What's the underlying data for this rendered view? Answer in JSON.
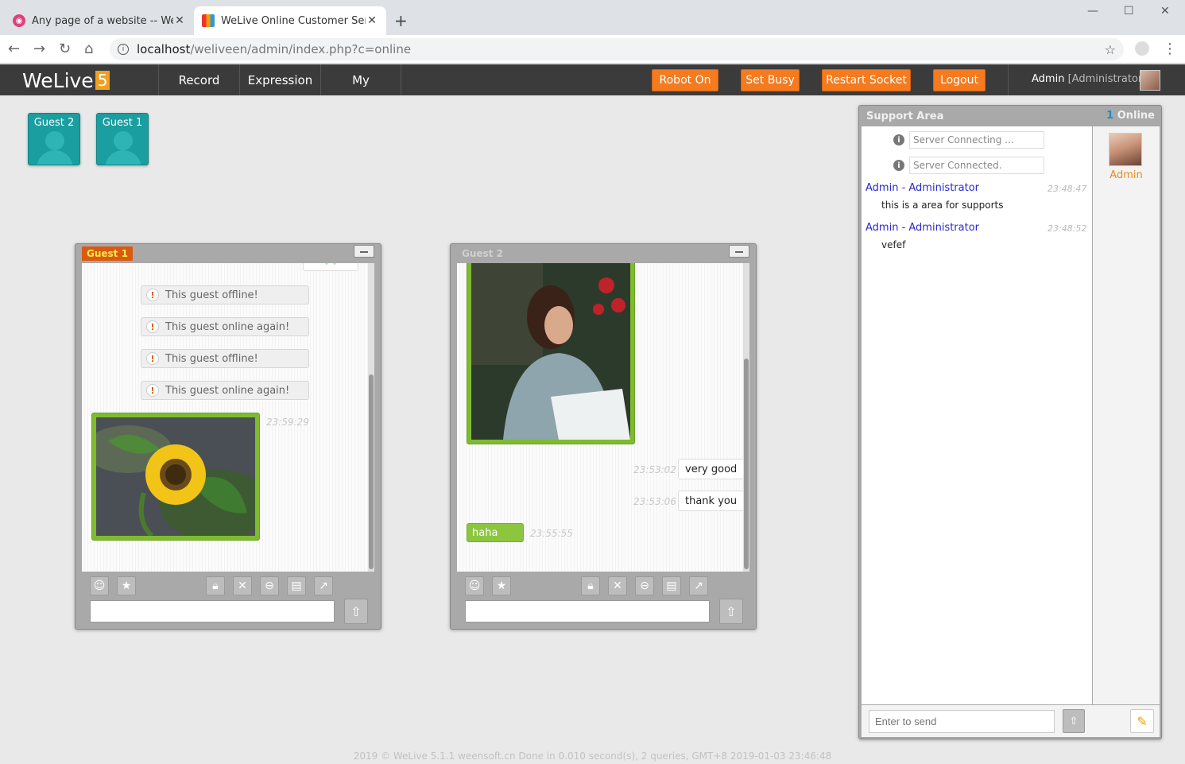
{
  "browser": {
    "tabs": [
      {
        "title": "Any page of a website -- WeLive",
        "active": false
      },
      {
        "title": "WeLive Online Customer Service",
        "active": true
      }
    ],
    "url_host": "localhost",
    "url_path": "/weliveen/admin/index.php?c=online"
  },
  "app": {
    "logo": "WeLive",
    "logo_version": "5",
    "menu": [
      "Record",
      "Expression",
      "My"
    ],
    "buttons": {
      "robot": "Robot On",
      "busy": "Set Busy",
      "restart": "Restart Socket",
      "logout": "Logout"
    },
    "user": {
      "name": "Admin",
      "role": "[Administrator]"
    },
    "accent_color": "#f47b20",
    "header_color": "#3b3b3b"
  },
  "guest_tiles": [
    "Guest 2",
    "Guest 1"
  ],
  "chat_windows": [
    {
      "title": "Guest 1",
      "system_messages": [
        "This guest offline!",
        "This guest online again!",
        "This guest offline!",
        "This guest online again!"
      ],
      "image_time": "23:59:29"
    },
    {
      "title": "Guest 2",
      "messages": [
        {
          "text": "very good",
          "time": "23:53:02"
        },
        {
          "text": "thank you",
          "time": "23:53:06"
        },
        {
          "text": "haha",
          "time": "23:55:55"
        }
      ]
    }
  ],
  "support": {
    "title": "Support Area",
    "online_count": "1",
    "online_label": "Online",
    "status": [
      "Server Connecting ...",
      "Server Connected."
    ],
    "messages": [
      {
        "from": "Admin - Administrator",
        "time": "23:48:47",
        "text": "this is a area for supports"
      },
      {
        "from": "Admin - Administrator",
        "time": "23:48:52",
        "text": "vefef"
      }
    ],
    "user": "Admin",
    "input_placeholder": "Enter to send"
  },
  "footer": "2019 © WeLive 5.1.1 weensoft.cn Done in 0.010 second(s), 2 queries, GMT+8 2019-01-03 23:46:48"
}
